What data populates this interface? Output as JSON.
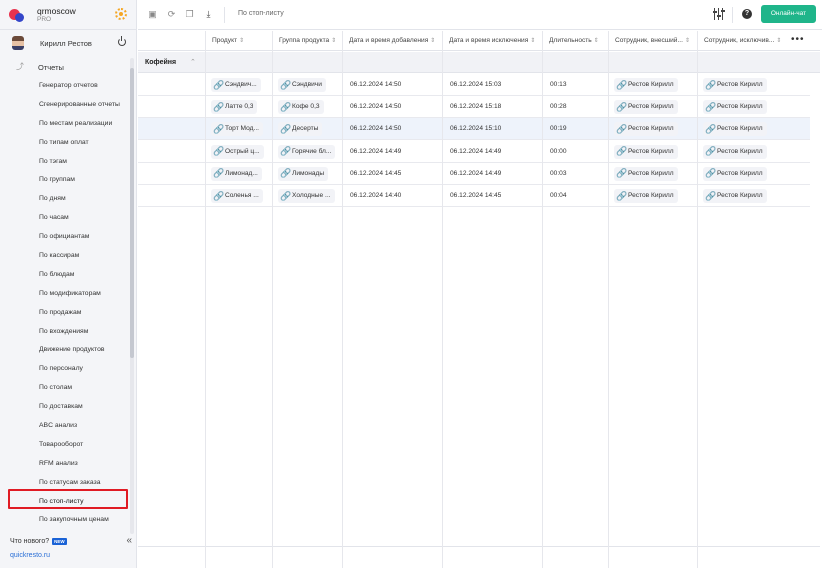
{
  "account": {
    "name": "qrmoscow",
    "plan": "PRO"
  },
  "user": {
    "name": "Кирилл Рестов"
  },
  "sidebar": {
    "section_label": "Отчеты",
    "items": [
      "Генератор отчетов",
      "Сгенерированные отчеты",
      "По местам реализации",
      "По типам оплат",
      "По тэгам",
      "По группам",
      "По дням",
      "По часам",
      "По официантам",
      "По кассирам",
      "По блюдам",
      "По модификаторам",
      "По продажам",
      "По вхождениям",
      "Движение продуктов",
      "По персоналу",
      "По столам",
      "По доставкам",
      "ABC анализ",
      "Товарооборот",
      "RFM анализ",
      "По статусам заказа",
      "По стоп-листу",
      "По закупочным ценам"
    ],
    "active_item": "По стоп-листу",
    "whats_new_label": "Что нового?",
    "new_badge": "NEW",
    "site_link": "quickresto.ru"
  },
  "toolbar": {
    "title": "По стоп-листу",
    "chat_label": "Онлайн-чат",
    "help_label": "?"
  },
  "table": {
    "columns": [
      "Продукт",
      "Группа продукта",
      "Дата и время добавления",
      "Дата и время исключения",
      "Длительность",
      "Сотрудник, внесший...",
      "Сотрудник, исключив..."
    ],
    "group_label": "Кофейня",
    "rows": [
      {
        "product": "Сэндвич...",
        "group": "Сэндвичи",
        "added": "06.12.2024 14:50",
        "removed": "06.12.2024 15:03",
        "duration": "00:13",
        "emp_add": "Рестов Кирилл",
        "emp_rem": "Рестов Кирилл"
      },
      {
        "product": "Латте 0,3",
        "group": "Кофе 0,3",
        "added": "06.12.2024 14:50",
        "removed": "06.12.2024 15:18",
        "duration": "00:28",
        "emp_add": "Рестов Кирилл",
        "emp_rem": "Рестов Кирилл"
      },
      {
        "product": "Торт Мод...",
        "group": "Десерты",
        "added": "06.12.2024 14:50",
        "removed": "06.12.2024 15:10",
        "duration": "00:19",
        "emp_add": "Рестов Кирилл",
        "emp_rem": "Рестов Кирилл"
      },
      {
        "product": "Острый ц...",
        "group": "Горячие бл...",
        "added": "06.12.2024 14:49",
        "removed": "06.12.2024 14:49",
        "duration": "00:00",
        "emp_add": "Рестов Кирилл",
        "emp_rem": "Рестов Кирилл"
      },
      {
        "product": "Лимонад...",
        "group": "Лимонады",
        "added": "06.12.2024 14:45",
        "removed": "06.12.2024 14:49",
        "duration": "00:03",
        "emp_add": "Рестов Кирилл",
        "emp_rem": "Рестов Кирилл"
      },
      {
        "product": "Соленья ...",
        "group": "Холодные ...",
        "added": "06.12.2024 14:40",
        "removed": "06.12.2024 14:45",
        "duration": "00:04",
        "emp_add": "Рестов Кирилл",
        "emp_rem": "Рестов Кирилл"
      }
    ],
    "selected_row": 2
  },
  "colors": {
    "accent": "#1fb58a",
    "highlight": "#e01b24",
    "link": "#3d7be0",
    "badge": "#1a62d6"
  }
}
